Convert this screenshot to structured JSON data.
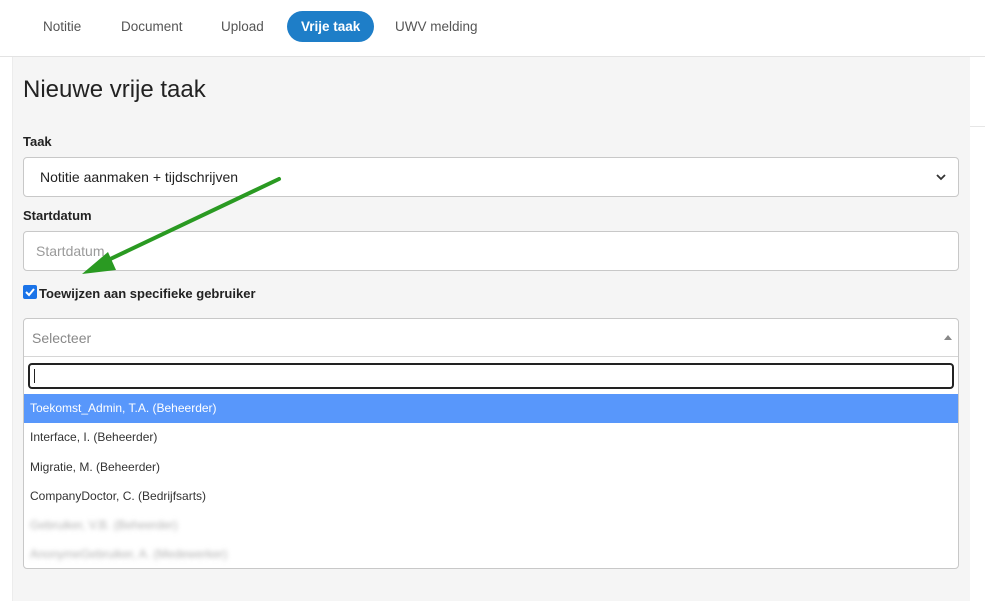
{
  "tabs": [
    {
      "label": "Notitie",
      "active": false
    },
    {
      "label": "Document",
      "active": false
    },
    {
      "label": "Upload",
      "active": false
    },
    {
      "label": "Vrije taak",
      "active": true
    },
    {
      "label": "UWV melding",
      "active": false
    }
  ],
  "form": {
    "title": "Nieuwe vrije taak",
    "taak_label": "Taak",
    "taak_value": "Notitie aanmaken + tijdschrijven",
    "startdatum_label": "Startdatum",
    "startdatum_placeholder": "Startdatum",
    "assign_checked": true,
    "assign_label": "Toewijzen aan specifieke gebruiker",
    "user_select": {
      "placeholder": "Selecteer",
      "search_value": "",
      "options": [
        {
          "label": "Toekomst_Admin, T.A. (Beheerder)",
          "highlighted": true
        },
        {
          "label": "Interface, I. (Beheerder)",
          "highlighted": false
        },
        {
          "label": "Migratie, M. (Beheerder)",
          "highlighted": false
        },
        {
          "label": "CompanyDoctor, C. (Bedrijfsarts)",
          "highlighted": false
        },
        {
          "label": "Gebruiker, V.B. (Beheerder)",
          "highlighted": false,
          "blurred": true
        },
        {
          "label": "AnonymeGebruiker, A. (Medewerker)",
          "highlighted": false,
          "blurred": true
        }
      ]
    }
  },
  "colors": {
    "accent": "#1e7ec8",
    "highlight": "#5897fb",
    "annotation_arrow": "#2a9a22"
  },
  "icons": {
    "select_chevron": "chevron-down-icon",
    "select2_arrow": "caret-up-icon",
    "annotation": "arrow-annotation"
  }
}
